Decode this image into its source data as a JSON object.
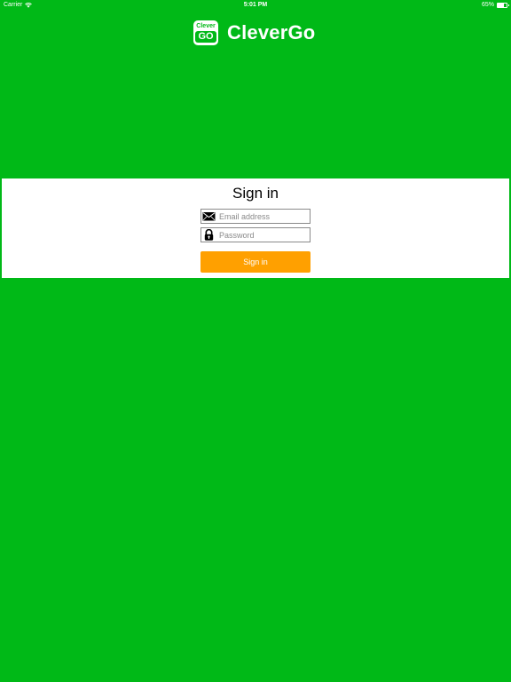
{
  "status_bar": {
    "carrier": "Carrier",
    "time": "5:01 PM",
    "battery_text": "65%",
    "battery_level": 0.65
  },
  "brand": {
    "badge_top": "Clever",
    "badge_bottom": "GO",
    "name": "CleverGo"
  },
  "signin": {
    "title": "Sign in",
    "email_placeholder": "Email address",
    "email_value": "",
    "password_placeholder": "Password",
    "password_value": "",
    "button_label": "Sign in"
  },
  "colors": {
    "background": "#00b917",
    "panel": "#ffffff",
    "button": "#ffa000",
    "text_on_green": "#ffffff"
  },
  "icons": {
    "wifi": "wifi-icon",
    "battery": "battery-icon",
    "email": "envelope-icon",
    "password": "lock-icon"
  }
}
